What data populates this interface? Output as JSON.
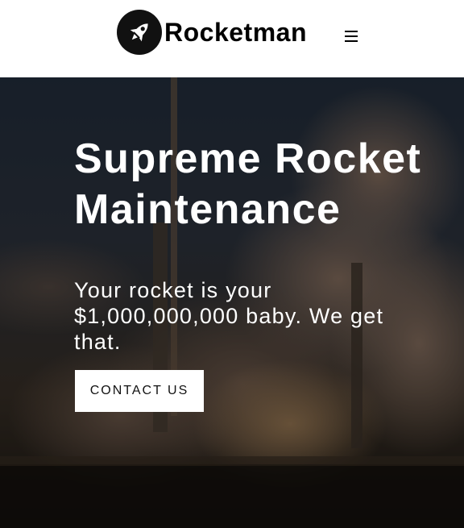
{
  "header": {
    "brand": "Rocketman",
    "logo_icon": "rocket-icon",
    "menu_icon": "hamburger-menu-icon"
  },
  "hero": {
    "title": "Supreme Rocket Maintenance",
    "subtitle": "Your rocket is your $1,000,000,000 baby. We get that.",
    "cta_label": "CONTACT US",
    "background": "rocket-launch-photo"
  },
  "colors": {
    "header_bg": "#ffffff",
    "text_dark": "#000000",
    "hero_text": "#ffffff",
    "button_bg": "#ffffff"
  }
}
